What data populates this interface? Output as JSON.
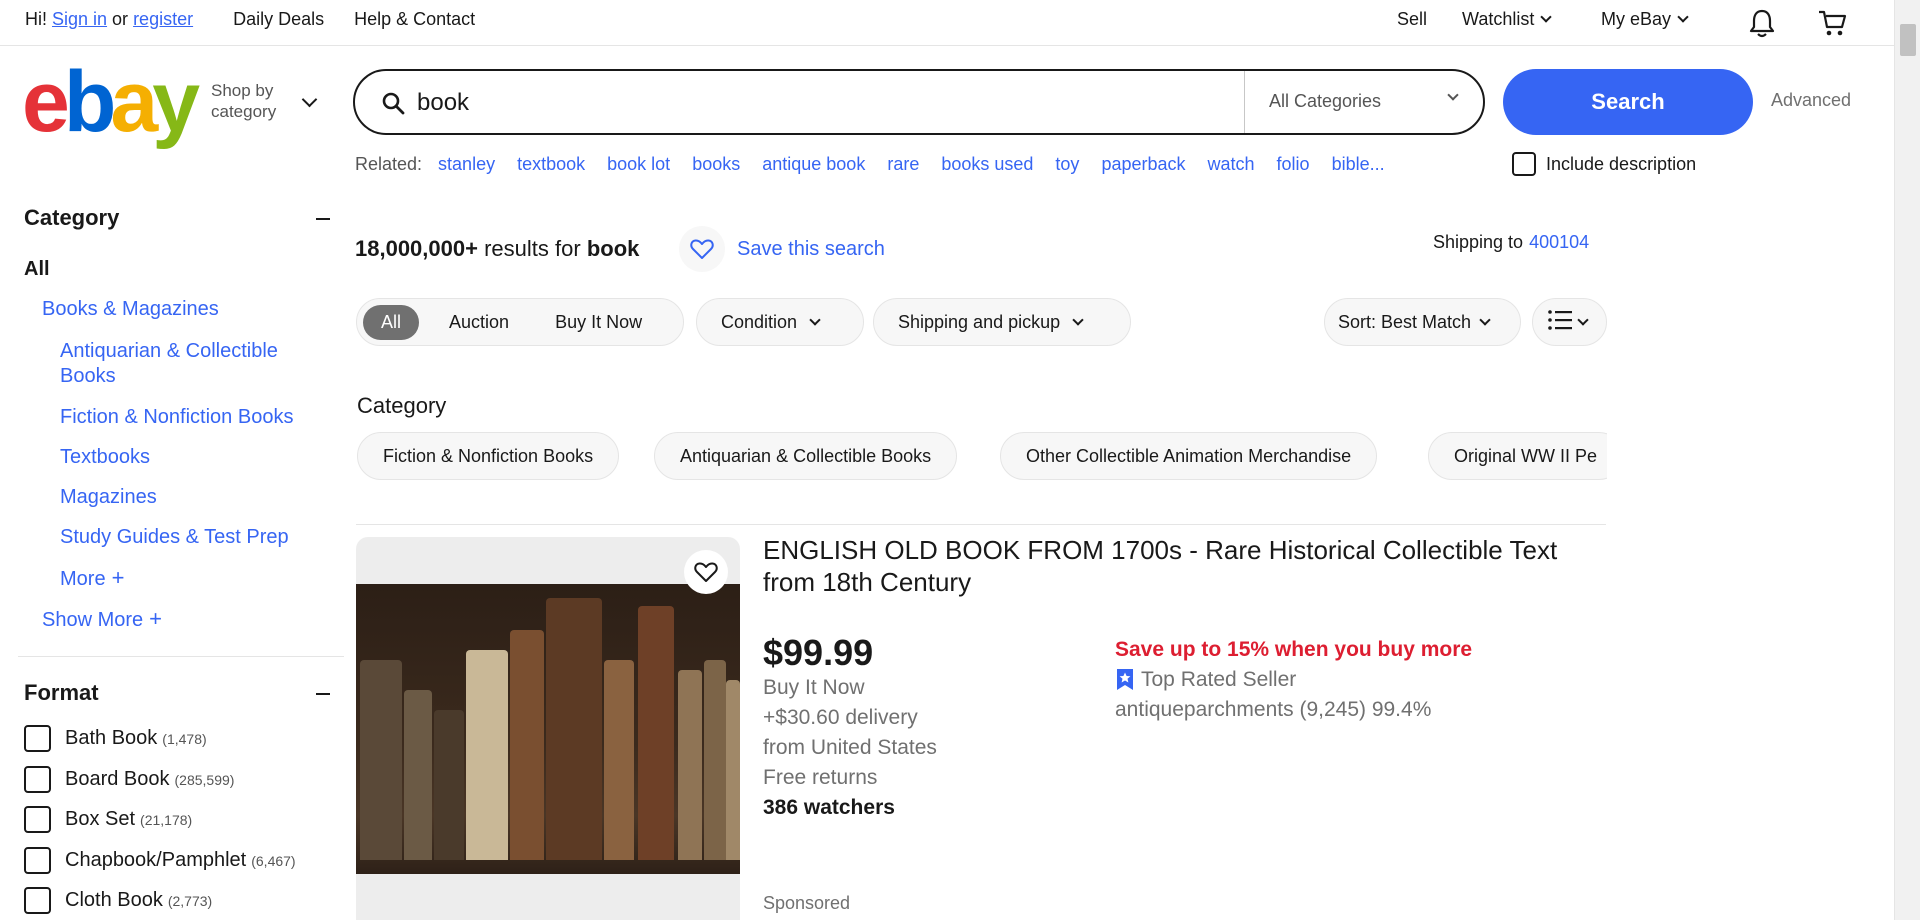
{
  "topbar": {
    "greeting": "Hi!",
    "sign_in": "Sign in",
    "or": "or",
    "register": "register",
    "daily_deals": "Daily Deals",
    "help_contact": "Help & Contact",
    "sell": "Sell",
    "watchlist": "Watchlist",
    "my_ebay": "My eBay"
  },
  "header": {
    "logo": [
      "e",
      "b",
      "a",
      "y"
    ],
    "shop_by_line1": "Shop by",
    "shop_by_line2": "category",
    "search_value": "book",
    "category_select": "All Categories",
    "search_button": "Search",
    "advanced": "Advanced"
  },
  "related": {
    "label": "Related:",
    "tags": [
      "stanley",
      "textbook",
      "book lot",
      "books",
      "antique book",
      "rare",
      "books used",
      "toy",
      "paperback",
      "watch",
      "folio",
      "bible..."
    ],
    "include_description": "Include description"
  },
  "sidebar": {
    "category_heading": "Category",
    "all": "All",
    "books_magazines": "Books & Magazines",
    "subcats": [
      "Antiquarian & Collectible",
      "Books",
      "Fiction & Nonfiction Books",
      "Textbooks",
      "Magazines",
      "Study Guides & Test Prep"
    ],
    "more": "More",
    "show_more": "Show More",
    "format_heading": "Format",
    "formats": [
      {
        "label": "Bath Book",
        "count": "(1,478)"
      },
      {
        "label": "Board Book",
        "count": "(285,599)"
      },
      {
        "label": "Box Set",
        "count": "(21,178)"
      },
      {
        "label": "Chapbook/Pamphlet",
        "count": "(6,467)"
      },
      {
        "label": "Cloth Book",
        "count": "(2,773)"
      }
    ]
  },
  "results": {
    "count": "18,000,000+",
    "results_for": "results for",
    "query": "book",
    "save_search": "Save this search",
    "shipping_to": "Shipping to",
    "zip": "400104"
  },
  "filters": {
    "all": "All",
    "auction": "Auction",
    "buy_it_now": "Buy It Now",
    "condition": "Condition",
    "shipping_pickup": "Shipping and pickup",
    "sort": "Sort: Best Match"
  },
  "category_chips": {
    "heading": "Category",
    "chips": [
      "Fiction & Nonfiction Books",
      "Antiquarian & Collectible Books",
      "Other Collectible Animation Merchandise",
      "Original WW II Pe"
    ]
  },
  "listing": {
    "title": "ENGLISH OLD BOOK FROM 1700s - Rare Historical Collectible Text from 18th Century",
    "price": "$99.99",
    "format": "Buy It Now",
    "delivery": "+$30.60 delivery",
    "origin": "from United States",
    "returns": "Free returns",
    "watchers": "386 watchers",
    "sponsored": "Sponsored",
    "promo": "Save up to 15% when you buy more",
    "top_rated": "Top Rated Seller",
    "seller": "antiqueparchments (9,245) 99.4%"
  },
  "colors": {
    "link_blue": "#3665f3",
    "promo_red": "#dd1e31",
    "logo_red": "#e53238",
    "logo_blue": "#0064d2",
    "logo_yellow": "#f5af02",
    "logo_green": "#86b817"
  }
}
